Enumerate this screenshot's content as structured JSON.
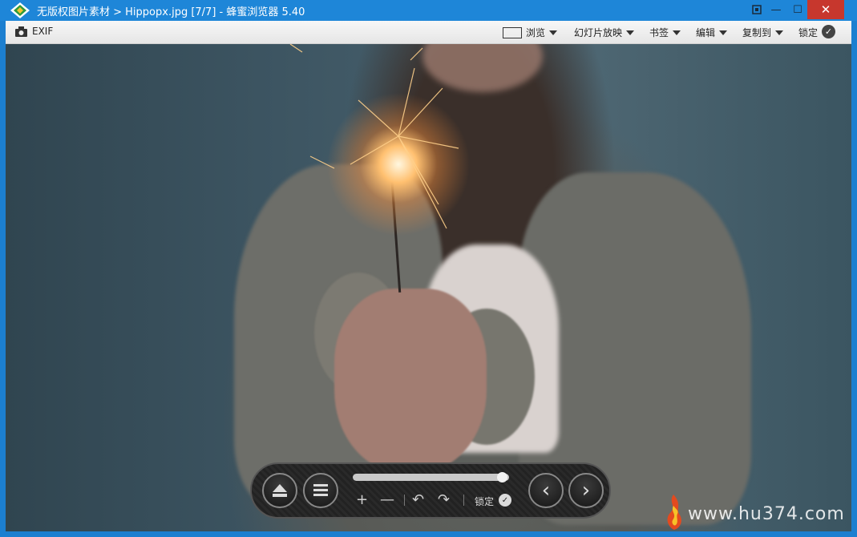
{
  "window": {
    "title": "无版权图片素材 > Hippopx.jpg [7/7] - 蜂蜜浏览器 5.40",
    "close_glyph": "✕",
    "maximize_glyph": "☐",
    "minimize_glyph": "—"
  },
  "toolbar": {
    "exif_label": "EXIF",
    "menus": [
      {
        "label": "浏览"
      },
      {
        "label": "幻灯片放映"
      },
      {
        "label": "书签"
      },
      {
        "label": "编辑"
      },
      {
        "label": "复制到"
      }
    ],
    "lock_label": "锁定"
  },
  "controls": {
    "lock_label": "锁定",
    "zoom_in": "+",
    "zoom_out": "—",
    "rotate_left": "↶",
    "rotate_right": "↷",
    "prev": "‹",
    "next": "›",
    "progress": 0.99
  },
  "watermark": {
    "text": "www.hu374.com"
  },
  "colors": {
    "titlebar": "#1e86d8",
    "close_button": "#c7372d",
    "toolbar_bg": "#efefef"
  },
  "icons": [
    "app-icon",
    "camera-icon",
    "screenshot-icon",
    "minimize-icon",
    "maximize-icon",
    "close-icon",
    "fullscreen-frame-icon",
    "caret-down-icon",
    "check-icon",
    "eject-icon",
    "menu-icon",
    "zoom-in-icon",
    "zoom-out-icon",
    "rotate-left-icon",
    "rotate-right-icon",
    "previous-icon",
    "next-icon"
  ]
}
